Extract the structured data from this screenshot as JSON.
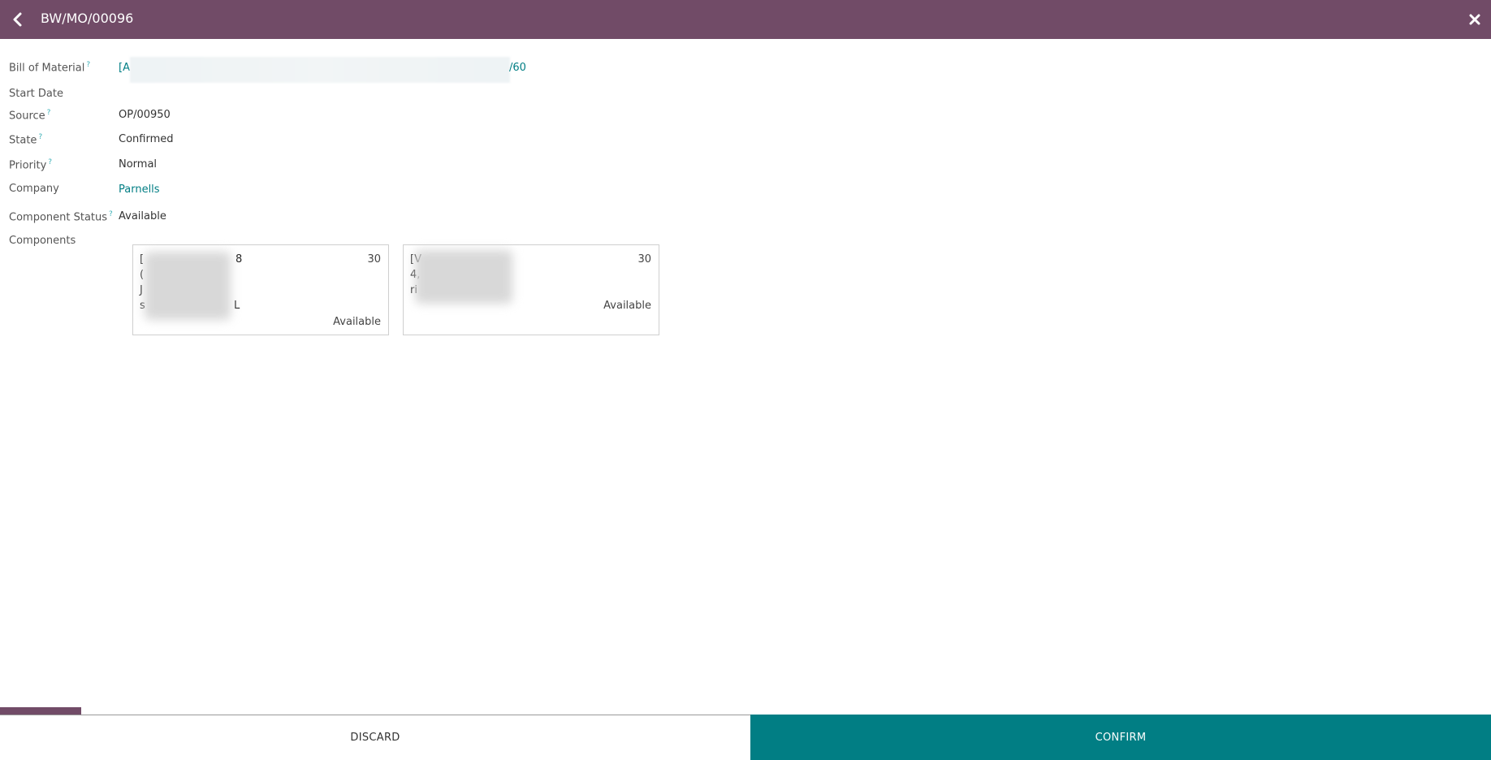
{
  "header": {
    "title": "BW/MO/00096",
    "back_icon": "chevron-left-icon",
    "close_icon": "close-icon"
  },
  "fields": {
    "bill_of_material": {
      "label": "Bill of Material",
      "help": "?",
      "value_start": "[A",
      "value_end": "/60"
    },
    "start_date": {
      "label": "Start Date",
      "value": ""
    },
    "source": {
      "label": "Source",
      "help": "?",
      "value": "OP/00950"
    },
    "state": {
      "label": "State",
      "help": "?",
      "value": "Confirmed"
    },
    "priority": {
      "label": "Priority",
      "help": "?",
      "value": "Normal"
    },
    "company": {
      "label": "Company",
      "value": "Parnells"
    },
    "component_status": {
      "label": "Component Status",
      "help": "?",
      "value": "Available"
    },
    "components": {
      "label": "Components"
    }
  },
  "components": [
    {
      "lines": [
        "[",
        "(",
        "J",
        "s"
      ],
      "line_ends": [
        "8",
        "",
        "",
        "L"
      ],
      "quantity": "30",
      "status": "Available"
    },
    {
      "lines": [
        "[V",
        "4,",
        "ri"
      ],
      "quantity": "30",
      "status": "Available"
    }
  ],
  "footer": {
    "discard_label": "DISCARD",
    "confirm_label": "CONFIRM"
  },
  "colors": {
    "brand": "#714b67",
    "primary": "#017e84",
    "link": "#017e84"
  }
}
